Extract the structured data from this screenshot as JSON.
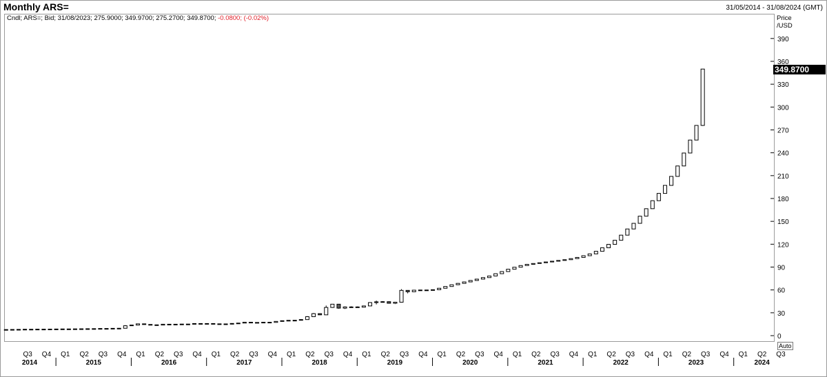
{
  "header": {
    "title": "Monthly ARS=",
    "date_range": "31/05/2014 - 31/08/2024 (GMT)"
  },
  "info_line": {
    "prefix": "Cndl; ARS=; Bid; 31/08/2023; 275.9000; 349.9700; 275.2700; 349.8700;",
    "change": "-0.0800; (-0.02%)"
  },
  "axis": {
    "y_title_line1": "Price",
    "y_title_line2": "/USD",
    "auto_button": "Auto",
    "last_price_label": "349.8700"
  },
  "colors": {
    "up_fill": "#ffffff",
    "down_fill": "#5a5a5a",
    "candle_stroke": "#000000",
    "last_label_bg": "#000000",
    "negative_change": "#e0202a"
  },
  "chart_data": {
    "type": "candlestick",
    "title": "Monthly ARS=",
    "ylabel": "Price /USD",
    "ylim": [
      -7,
      420
    ],
    "y_ticks": [
      0,
      30,
      60,
      90,
      120,
      150,
      180,
      210,
      240,
      270,
      300,
      330,
      360,
      390
    ],
    "quarter_ticks": [
      "Q3",
      "Q4",
      "Q1",
      "Q2",
      "Q3",
      "Q4",
      "Q1",
      "Q2",
      "Q3",
      "Q4",
      "Q1",
      "Q2",
      "Q3",
      "Q4",
      "Q1",
      "Q2",
      "Q3",
      "Q4",
      "Q1",
      "Q2",
      "Q3",
      "Q4",
      "Q1",
      "Q2",
      "Q3",
      "Q4",
      "Q1",
      "Q2",
      "Q3",
      "Q4",
      "Q1",
      "Q2",
      "Q3",
      "Q4",
      "Q1",
      "Q2",
      "Q3",
      "Q4",
      "Q1",
      "Q2",
      "Q3"
    ],
    "year_labels": [
      "2014",
      "2015",
      "2016",
      "2017",
      "2018",
      "2019",
      "2020",
      "2021",
      "2022",
      "2023",
      "2024"
    ],
    "x_start": "2014-05",
    "x_end": "2024-08",
    "last_value": 349.87,
    "candles": [
      {
        "date": "2014-05",
        "open": 7.9,
        "high": 8.1,
        "low": 7.9,
        "close": 8.0
      },
      {
        "date": "2014-06",
        "open": 8.0,
        "high": 8.2,
        "low": 8.0,
        "close": 8.1
      },
      {
        "date": "2014-07",
        "open": 8.1,
        "high": 8.3,
        "low": 8.1,
        "close": 8.2
      },
      {
        "date": "2014-08",
        "open": 8.2,
        "high": 8.4,
        "low": 8.2,
        "close": 8.4
      },
      {
        "date": "2014-09",
        "open": 8.4,
        "high": 8.5,
        "low": 8.4,
        "close": 8.4
      },
      {
        "date": "2014-10",
        "open": 8.4,
        "high": 8.5,
        "low": 8.4,
        "close": 8.5
      },
      {
        "date": "2014-11",
        "open": 8.5,
        "high": 8.6,
        "low": 8.5,
        "close": 8.5
      },
      {
        "date": "2014-12",
        "open": 8.5,
        "high": 8.6,
        "low": 8.5,
        "close": 8.6
      },
      {
        "date": "2015-01",
        "open": 8.6,
        "high": 8.7,
        "low": 8.6,
        "close": 8.7
      },
      {
        "date": "2015-02",
        "open": 8.7,
        "high": 8.8,
        "low": 8.7,
        "close": 8.8
      },
      {
        "date": "2015-03",
        "open": 8.8,
        "high": 8.9,
        "low": 8.8,
        "close": 8.8
      },
      {
        "date": "2015-04",
        "open": 8.8,
        "high": 8.9,
        "low": 8.8,
        "close": 8.9
      },
      {
        "date": "2015-05",
        "open": 8.9,
        "high": 9.0,
        "low": 8.9,
        "close": 9.0
      },
      {
        "date": "2015-06",
        "open": 9.0,
        "high": 9.1,
        "low": 9.0,
        "close": 9.1
      },
      {
        "date": "2015-07",
        "open": 9.1,
        "high": 9.2,
        "low": 9.1,
        "close": 9.2
      },
      {
        "date": "2015-08",
        "open": 9.2,
        "high": 9.4,
        "low": 9.2,
        "close": 9.4
      },
      {
        "date": "2015-09",
        "open": 9.4,
        "high": 9.5,
        "low": 9.4,
        "close": 9.4
      },
      {
        "date": "2015-10",
        "open": 9.4,
        "high": 9.6,
        "low": 9.4,
        "close": 9.6
      },
      {
        "date": "2015-11",
        "open": 9.6,
        "high": 9.8,
        "low": 9.6,
        "close": 9.7
      },
      {
        "date": "2015-12",
        "open": 9.7,
        "high": 13.8,
        "low": 9.7,
        "close": 13.0
      },
      {
        "date": "2016-01",
        "open": 13.0,
        "high": 14.1,
        "low": 12.9,
        "close": 13.9
      },
      {
        "date": "2016-02",
        "open": 13.9,
        "high": 15.9,
        "low": 13.8,
        "close": 15.5
      },
      {
        "date": "2016-03",
        "open": 15.5,
        "high": 15.6,
        "low": 14.6,
        "close": 14.7
      },
      {
        "date": "2016-04",
        "open": 14.7,
        "high": 14.8,
        "low": 14.1,
        "close": 14.2
      },
      {
        "date": "2016-05",
        "open": 14.2,
        "high": 14.2,
        "low": 13.8,
        "close": 13.9
      },
      {
        "date": "2016-06",
        "open": 13.9,
        "high": 15.1,
        "low": 13.9,
        "close": 15.0
      },
      {
        "date": "2016-07",
        "open": 15.0,
        "high": 15.1,
        "low": 14.8,
        "close": 15.0
      },
      {
        "date": "2016-08",
        "open": 15.0,
        "high": 15.1,
        "low": 14.8,
        "close": 15.0
      },
      {
        "date": "2016-09",
        "open": 15.0,
        "high": 15.3,
        "low": 15.0,
        "close": 15.2
      },
      {
        "date": "2016-10",
        "open": 15.2,
        "high": 15.3,
        "low": 15.1,
        "close": 15.2
      },
      {
        "date": "2016-11",
        "open": 15.2,
        "high": 16.0,
        "low": 15.1,
        "close": 15.9
      },
      {
        "date": "2016-12",
        "open": 15.9,
        "high": 16.1,
        "low": 15.5,
        "close": 15.8
      },
      {
        "date": "2017-01",
        "open": 15.8,
        "high": 16.1,
        "low": 15.7,
        "close": 15.9
      },
      {
        "date": "2017-02",
        "open": 15.9,
        "high": 15.9,
        "low": 15.4,
        "close": 15.5
      },
      {
        "date": "2017-03",
        "open": 15.5,
        "high": 15.7,
        "low": 15.3,
        "close": 15.4
      },
      {
        "date": "2017-04",
        "open": 15.4,
        "high": 15.5,
        "low": 15.2,
        "close": 15.4
      },
      {
        "date": "2017-05",
        "open": 15.4,
        "high": 16.1,
        "low": 15.3,
        "close": 16.0
      },
      {
        "date": "2017-06",
        "open": 16.0,
        "high": 16.6,
        "low": 15.9,
        "close": 16.5
      },
      {
        "date": "2017-07",
        "open": 16.5,
        "high": 17.8,
        "low": 16.5,
        "close": 17.6
      },
      {
        "date": "2017-08",
        "open": 17.6,
        "high": 17.8,
        "low": 17.1,
        "close": 17.3
      },
      {
        "date": "2017-09",
        "open": 17.3,
        "high": 17.5,
        "low": 17.1,
        "close": 17.3
      },
      {
        "date": "2017-10",
        "open": 17.3,
        "high": 17.7,
        "low": 17.3,
        "close": 17.6
      },
      {
        "date": "2017-11",
        "open": 17.6,
        "high": 17.7,
        "low": 17.3,
        "close": 17.4
      },
      {
        "date": "2017-12",
        "open": 17.4,
        "high": 18.8,
        "low": 17.4,
        "close": 18.7
      },
      {
        "date": "2018-01",
        "open": 18.7,
        "high": 19.8,
        "low": 18.6,
        "close": 19.6
      },
      {
        "date": "2018-02",
        "open": 19.6,
        "high": 20.3,
        "low": 19.5,
        "close": 20.1
      },
      {
        "date": "2018-03",
        "open": 20.1,
        "high": 20.3,
        "low": 20.0,
        "close": 20.2
      },
      {
        "date": "2018-04",
        "open": 20.2,
        "high": 21.4,
        "low": 20.1,
        "close": 21.1
      },
      {
        "date": "2018-05",
        "open": 21.1,
        "high": 25.6,
        "low": 21.0,
        "close": 24.9
      },
      {
        "date": "2018-06",
        "open": 24.9,
        "high": 29.7,
        "low": 24.9,
        "close": 28.9
      },
      {
        "date": "2018-07",
        "open": 28.9,
        "high": 29.2,
        "low": 27.1,
        "close": 27.3
      },
      {
        "date": "2018-08",
        "open": 27.3,
        "high": 39.5,
        "low": 27.2,
        "close": 37.0
      },
      {
        "date": "2018-09",
        "open": 37.0,
        "high": 41.3,
        "low": 36.5,
        "close": 41.3
      },
      {
        "date": "2018-10",
        "open": 41.3,
        "high": 41.3,
        "low": 35.4,
        "close": 36.1
      },
      {
        "date": "2018-11",
        "open": 36.1,
        "high": 38.4,
        "low": 35.0,
        "close": 37.7
      },
      {
        "date": "2018-12",
        "open": 37.7,
        "high": 38.5,
        "low": 37.2,
        "close": 37.7
      },
      {
        "date": "2019-01",
        "open": 37.7,
        "high": 38.3,
        "low": 36.9,
        "close": 37.4
      },
      {
        "date": "2019-02",
        "open": 37.4,
        "high": 39.4,
        "low": 37.1,
        "close": 39.0
      },
      {
        "date": "2019-03",
        "open": 39.0,
        "high": 44.0,
        "low": 38.8,
        "close": 43.4
      },
      {
        "date": "2019-04",
        "open": 43.4,
        "high": 46.0,
        "low": 41.0,
        "close": 44.4
      },
      {
        "date": "2019-05",
        "open": 44.4,
        "high": 45.2,
        "low": 43.5,
        "close": 44.6
      },
      {
        "date": "2019-06",
        "open": 44.6,
        "high": 44.9,
        "low": 42.2,
        "close": 42.5
      },
      {
        "date": "2019-07",
        "open": 42.5,
        "high": 43.9,
        "low": 41.5,
        "close": 43.9
      },
      {
        "date": "2019-08",
        "open": 43.9,
        "high": 61.0,
        "low": 43.9,
        "close": 59.4
      },
      {
        "date": "2019-09",
        "open": 59.4,
        "high": 59.6,
        "low": 55.5,
        "close": 57.6
      },
      {
        "date": "2019-10",
        "open": 57.6,
        "high": 60.1,
        "low": 57.4,
        "close": 59.7
      },
      {
        "date": "2019-11",
        "open": 59.7,
        "high": 60.2,
        "low": 59.6,
        "close": 59.9
      },
      {
        "date": "2019-12",
        "open": 59.9,
        "high": 60.1,
        "low": 59.8,
        "close": 59.9
      },
      {
        "date": "2020-01",
        "open": 59.9,
        "high": 60.4,
        "low": 59.8,
        "close": 60.3
      },
      {
        "date": "2020-02",
        "open": 60.3,
        "high": 62.4,
        "low": 60.2,
        "close": 62.2
      },
      {
        "date": "2020-03",
        "open": 62.2,
        "high": 64.7,
        "low": 62.1,
        "close": 64.5
      },
      {
        "date": "2020-04",
        "open": 64.5,
        "high": 66.9,
        "low": 64.4,
        "close": 66.8
      },
      {
        "date": "2020-05",
        "open": 66.8,
        "high": 68.7,
        "low": 66.7,
        "close": 68.6
      },
      {
        "date": "2020-06",
        "open": 68.6,
        "high": 70.6,
        "low": 68.5,
        "close": 70.5
      },
      {
        "date": "2020-07",
        "open": 70.5,
        "high": 72.6,
        "low": 70.4,
        "close": 72.4
      },
      {
        "date": "2020-08",
        "open": 72.4,
        "high": 74.5,
        "low": 72.3,
        "close": 74.2
      },
      {
        "date": "2020-09",
        "open": 74.2,
        "high": 76.4,
        "low": 74.1,
        "close": 76.2
      },
      {
        "date": "2020-10",
        "open": 76.2,
        "high": 78.5,
        "low": 76.1,
        "close": 78.3
      },
      {
        "date": "2020-11",
        "open": 78.3,
        "high": 81.5,
        "low": 78.2,
        "close": 81.3
      },
      {
        "date": "2020-12",
        "open": 81.3,
        "high": 84.3,
        "low": 81.2,
        "close": 84.1
      },
      {
        "date": "2021-01",
        "open": 84.1,
        "high": 87.4,
        "low": 84.0,
        "close": 87.2
      },
      {
        "date": "2021-02",
        "open": 87.2,
        "high": 89.9,
        "low": 87.1,
        "close": 89.8
      },
      {
        "date": "2021-03",
        "open": 89.8,
        "high": 92.2,
        "low": 89.7,
        "close": 92.0
      },
      {
        "date": "2021-04",
        "open": 92.0,
        "high": 93.7,
        "low": 91.9,
        "close": 93.6
      },
      {
        "date": "2021-05",
        "open": 93.6,
        "high": 94.8,
        "low": 93.5,
        "close": 94.7
      },
      {
        "date": "2021-06",
        "open": 94.7,
        "high": 95.8,
        "low": 94.6,
        "close": 95.7
      },
      {
        "date": "2021-07",
        "open": 95.7,
        "high": 96.8,
        "low": 95.6,
        "close": 96.7
      },
      {
        "date": "2021-08",
        "open": 96.7,
        "high": 97.8,
        "low": 96.6,
        "close": 97.7
      },
      {
        "date": "2021-09",
        "open": 97.7,
        "high": 98.8,
        "low": 97.6,
        "close": 98.7
      },
      {
        "date": "2021-10",
        "open": 98.7,
        "high": 99.8,
        "low": 98.6,
        "close": 99.7
      },
      {
        "date": "2021-11",
        "open": 99.7,
        "high": 101.3,
        "low": 99.6,
        "close": 101.1
      },
      {
        "date": "2021-12",
        "open": 101.1,
        "high": 102.9,
        "low": 101.0,
        "close": 102.7
      },
      {
        "date": "2022-01",
        "open": 102.7,
        "high": 105.1,
        "low": 102.6,
        "close": 104.9
      },
      {
        "date": "2022-02",
        "open": 104.9,
        "high": 107.5,
        "low": 104.8,
        "close": 107.3
      },
      {
        "date": "2022-03",
        "open": 107.3,
        "high": 110.9,
        "low": 107.2,
        "close": 110.7
      },
      {
        "date": "2022-04",
        "open": 110.7,
        "high": 115.5,
        "low": 110.6,
        "close": 115.3
      },
      {
        "date": "2022-05",
        "open": 115.3,
        "high": 120.0,
        "low": 115.2,
        "close": 119.8
      },
      {
        "date": "2022-06",
        "open": 119.8,
        "high": 125.4,
        "low": 119.7,
        "close": 125.2
      },
      {
        "date": "2022-07",
        "open": 125.2,
        "high": 132.1,
        "low": 125.1,
        "close": 131.9
      },
      {
        "date": "2022-08",
        "open": 131.9,
        "high": 140.2,
        "low": 131.8,
        "close": 140.0
      },
      {
        "date": "2022-09",
        "open": 140.0,
        "high": 147.6,
        "low": 139.9,
        "close": 147.4
      },
      {
        "date": "2022-10",
        "open": 147.4,
        "high": 157.0,
        "low": 147.3,
        "close": 156.8
      },
      {
        "date": "2022-11",
        "open": 156.8,
        "high": 166.8,
        "low": 156.7,
        "close": 166.6
      },
      {
        "date": "2022-12",
        "open": 166.6,
        "high": 177.4,
        "low": 166.5,
        "close": 177.1
      },
      {
        "date": "2023-01",
        "open": 177.1,
        "high": 186.9,
        "low": 177.0,
        "close": 186.7
      },
      {
        "date": "2023-02",
        "open": 186.7,
        "high": 197.4,
        "low": 186.6,
        "close": 197.2
      },
      {
        "date": "2023-03",
        "open": 197.2,
        "high": 209.3,
        "low": 197.1,
        "close": 209.0
      },
      {
        "date": "2023-04",
        "open": 209.0,
        "high": 222.9,
        "low": 208.9,
        "close": 222.7
      },
      {
        "date": "2023-05",
        "open": 222.7,
        "high": 240.0,
        "low": 222.6,
        "close": 239.7
      },
      {
        "date": "2023-06",
        "open": 239.7,
        "high": 256.9,
        "low": 239.6,
        "close": 256.7
      },
      {
        "date": "2023-07",
        "open": 256.7,
        "high": 275.0,
        "low": 256.6,
        "close": 275.9
      },
      {
        "date": "2023-08",
        "open": 275.9,
        "high": 349.97,
        "low": 275.27,
        "close": 349.87
      }
    ]
  }
}
